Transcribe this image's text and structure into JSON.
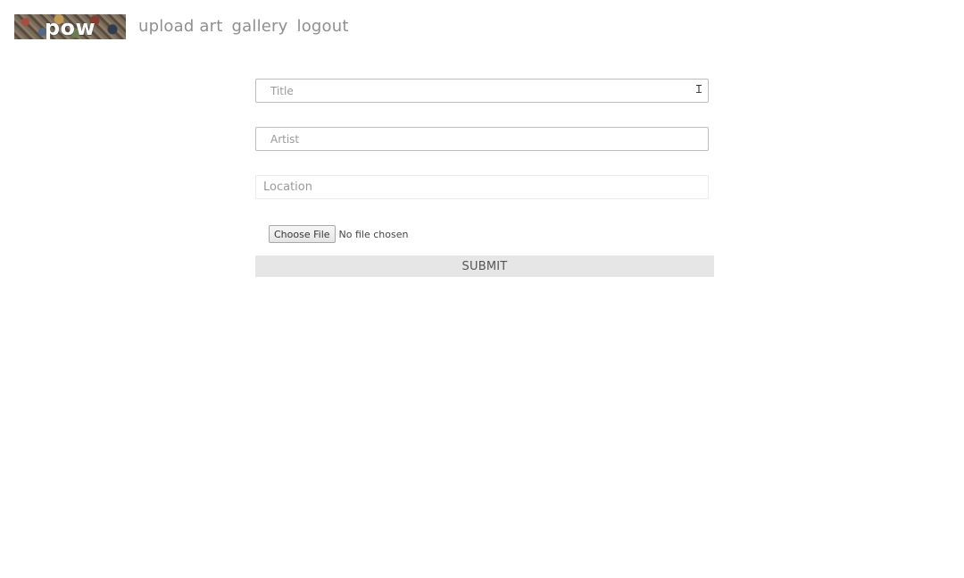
{
  "header": {
    "logo_text": "pow",
    "nav": [
      {
        "label": "upload art"
      },
      {
        "label": "gallery"
      },
      {
        "label": "logout"
      }
    ]
  },
  "form": {
    "title": {
      "placeholder": "Title",
      "value": ""
    },
    "artist": {
      "placeholder": "Artist",
      "value": ""
    },
    "location": {
      "placeholder": "Location",
      "value": ""
    },
    "file_button_label": "Choose File",
    "file_status": "No file chosen",
    "submit_label": "SUBMIT"
  }
}
